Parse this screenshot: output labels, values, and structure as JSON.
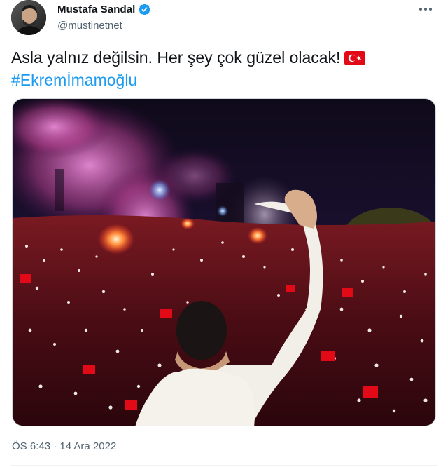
{
  "author": {
    "display_name": "Mustafa Sandal",
    "handle": "@mustinetnet",
    "verified": true,
    "avatar_icon": "profile-photo"
  },
  "tweet": {
    "text": "Asla yalnız değilsin. Her şey çok güzel olacak!",
    "flag_emoji": "turkey-flag-icon",
    "hashtag": "#Ekremİmamoğlu",
    "image_description_icon": "rally-photo"
  },
  "meta": {
    "time": "ÖS 6:43",
    "separator": "·",
    "date": "14 Ara 2022"
  },
  "colors": {
    "link": "#1d9bf0",
    "verified": "#1d9bf0",
    "text": "#0f1419",
    "secondary": "#536471",
    "flag_red": "#e30a17"
  }
}
